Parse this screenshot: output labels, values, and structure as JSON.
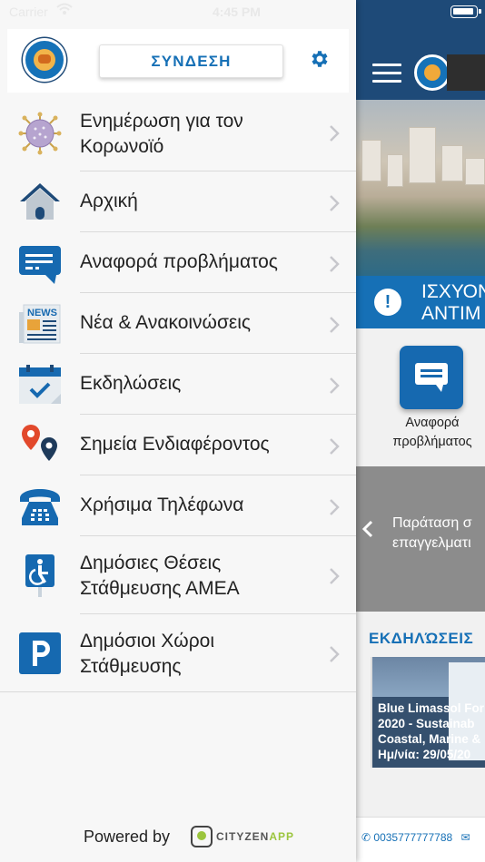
{
  "status_bar": {
    "carrier": "Carrier",
    "time": "4:45 PM"
  },
  "drawer": {
    "login_label": "ΣΥΝΔΕΣΗ",
    "menu": [
      {
        "id": "corona",
        "label": "Ενημέρωση για τον\nΚορωνοϊό",
        "icon": "virus-icon"
      },
      {
        "id": "home",
        "label": "Αρχική",
        "icon": "home-icon"
      },
      {
        "id": "report",
        "label": "Αναφορά προβλήματος",
        "icon": "message-icon"
      },
      {
        "id": "news",
        "label": "Νέα & Ανακοινώσεις",
        "icon": "newspaper-icon"
      },
      {
        "id": "events",
        "label": "Εκδηλώσεις",
        "icon": "calendar-icon"
      },
      {
        "id": "poi",
        "label": "Σημεία Ενδιαφέροντος",
        "icon": "map-pin-icon"
      },
      {
        "id": "phones",
        "label": "Χρήσιμα Τηλέφωνα",
        "icon": "telephone-icon"
      },
      {
        "id": "disabled_parking",
        "label": "Δημόσιες Θέσεις\nΣτάθμευσης ΑΜΕΑ",
        "icon": "accessible-parking-icon"
      },
      {
        "id": "parking",
        "label": "Δημόσιοι Χώροι\nΣτάθμευσης",
        "icon": "parking-icon"
      }
    ],
    "powered_by": "Powered by",
    "brand_name": "CITYZEN",
    "brand_suffix": "APP"
  },
  "main": {
    "alert_text": "ΙΣΧΥΟΝ\nΑΝΤΙΜ",
    "quick_action_label": "Αναφορά\nπροβλήματος",
    "news_text": "Παράταση σ\nεπαγγελματι",
    "events_title": "ΕΚΔΗΛΏΣΕΙΣ",
    "event_card_text": "Blue Limassol For\n2020 - Sustainab\nCoastal, Marine &\nΗμ/νία: 29/05/20",
    "footer_phone": "0035777777788"
  },
  "colors": {
    "accent": "#1670b6",
    "header_bg": "#1e4a78",
    "text": "#222222",
    "divider": "#dadada"
  }
}
